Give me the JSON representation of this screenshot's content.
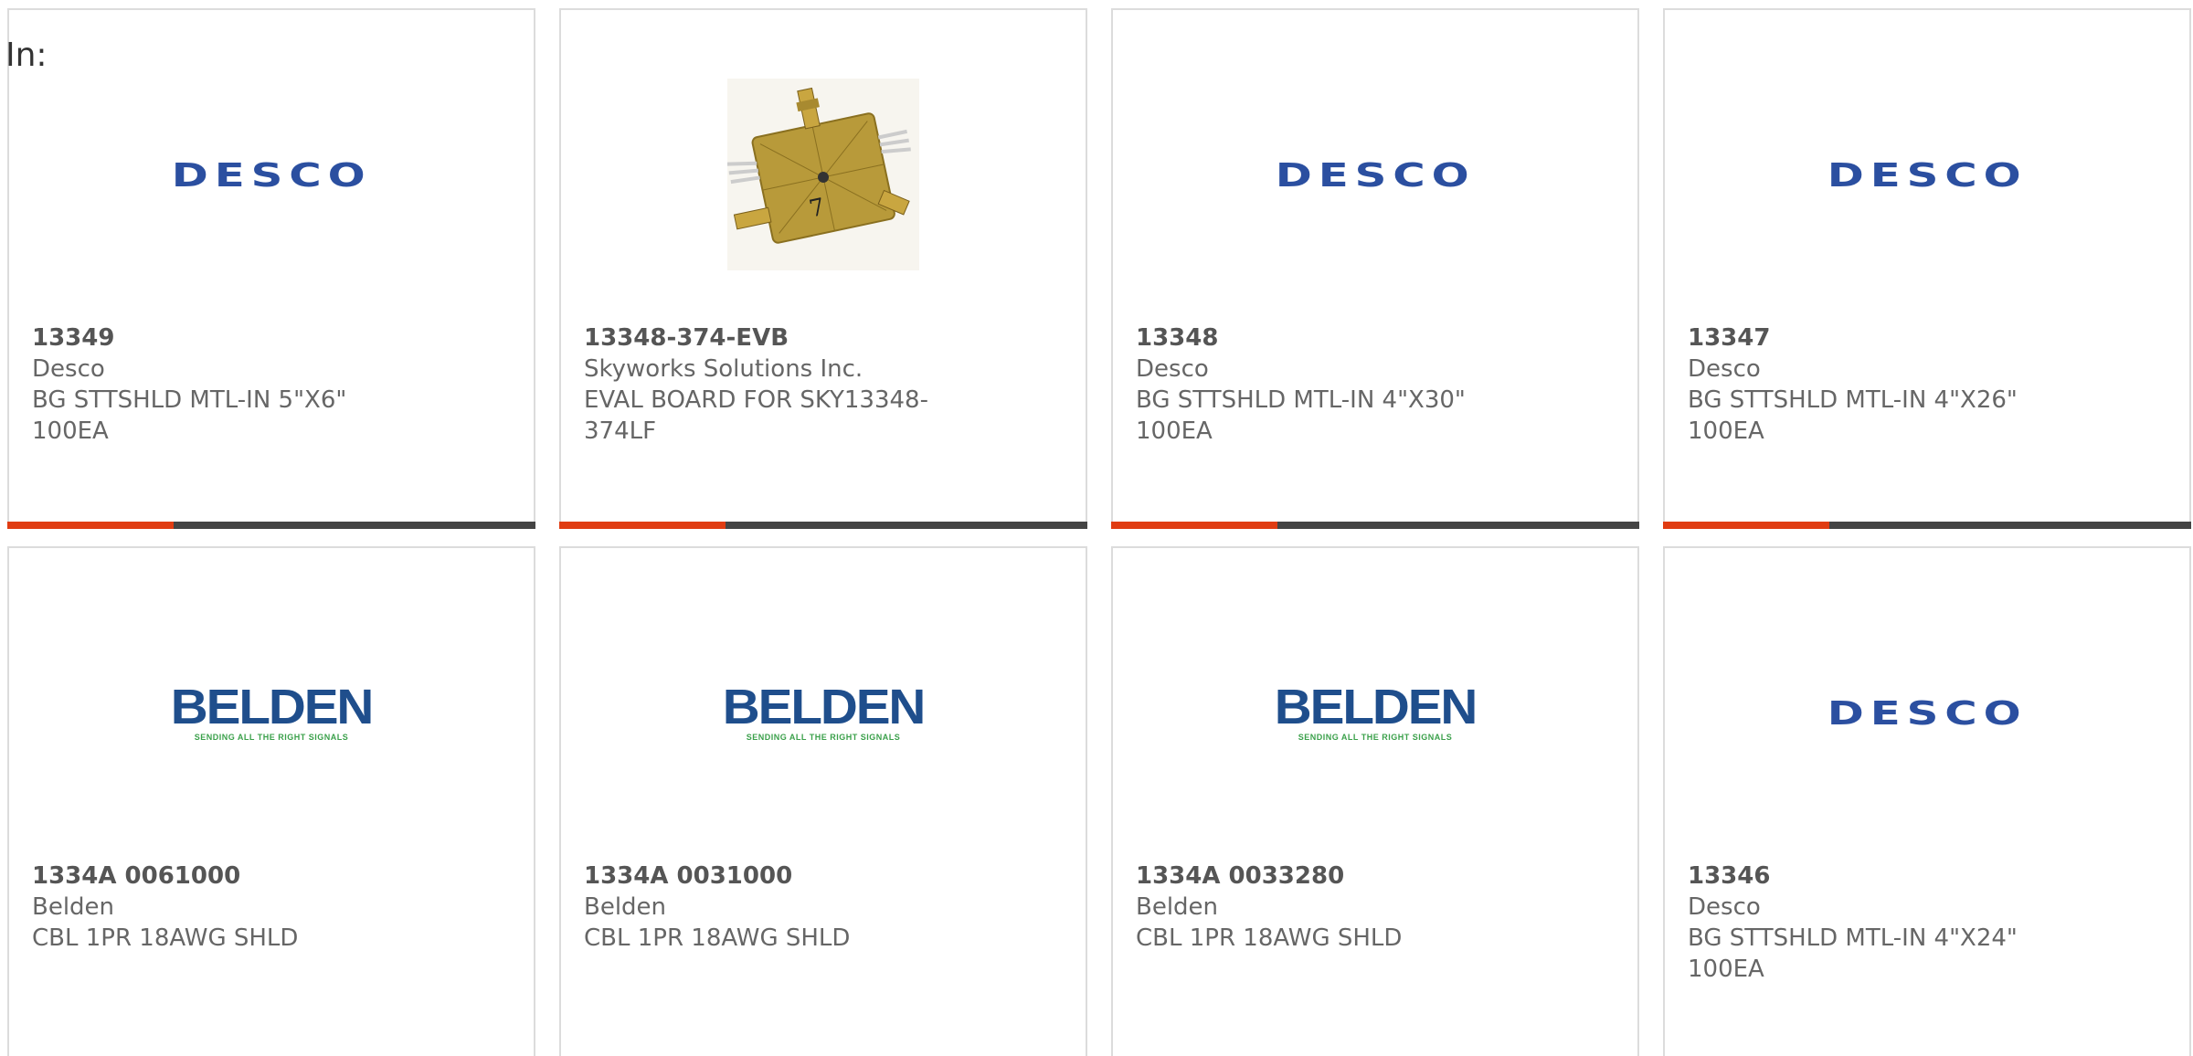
{
  "filter_label": "In:",
  "products": [
    {
      "part": "13349",
      "manufacturer": "Desco",
      "desc_line1": "BG STTSHLD MTL-IN 5\"X6\"",
      "desc_line2": "100EA",
      "logo": "DESCO"
    },
    {
      "part": "13348-374-EVB",
      "manufacturer": "Skyworks Solutions Inc.",
      "desc_line1": "EVAL BOARD FOR SKY13348-",
      "desc_line2": "374LF",
      "logo": "board-photo"
    },
    {
      "part": "13348",
      "manufacturer": "Desco",
      "desc_line1": "BG STTSHLD MTL-IN 4\"X30\"",
      "desc_line2": "100EA",
      "logo": "DESCO"
    },
    {
      "part": "13347",
      "manufacturer": "Desco",
      "desc_line1": "BG STTSHLD MTL-IN 4\"X26\"",
      "desc_line2": "100EA",
      "logo": "DESCO"
    },
    {
      "part": "1334A 0061000",
      "manufacturer": "Belden",
      "desc_line1": "CBL 1PR 18AWG SHLD",
      "desc_line2": "",
      "logo": "BELDEN",
      "logo_tag": "SENDING ALL THE RIGHT SIGNALS"
    },
    {
      "part": "1334A 0031000",
      "manufacturer": "Belden",
      "desc_line1": "CBL 1PR 18AWG SHLD",
      "desc_line2": "",
      "logo": "BELDEN",
      "logo_tag": "SENDING ALL THE RIGHT SIGNALS"
    },
    {
      "part": "1334A 0033280",
      "manufacturer": "Belden",
      "desc_line1": "CBL 1PR 18AWG SHLD",
      "desc_line2": "",
      "logo": "BELDEN",
      "logo_tag": "SENDING ALL THE RIGHT SIGNALS"
    },
    {
      "part": "13346",
      "manufacturer": "Desco",
      "desc_line1": "BG STTSHLD MTL-IN 4\"X24\"",
      "desc_line2": "100EA",
      "logo": "DESCO"
    }
  ],
  "colors": {
    "accent": "#e03c12",
    "bar_dark": "#444444",
    "desco_blue": "#2b4fa0",
    "belden_blue": "#1f4e8c",
    "belden_green": "#3aa04a"
  }
}
